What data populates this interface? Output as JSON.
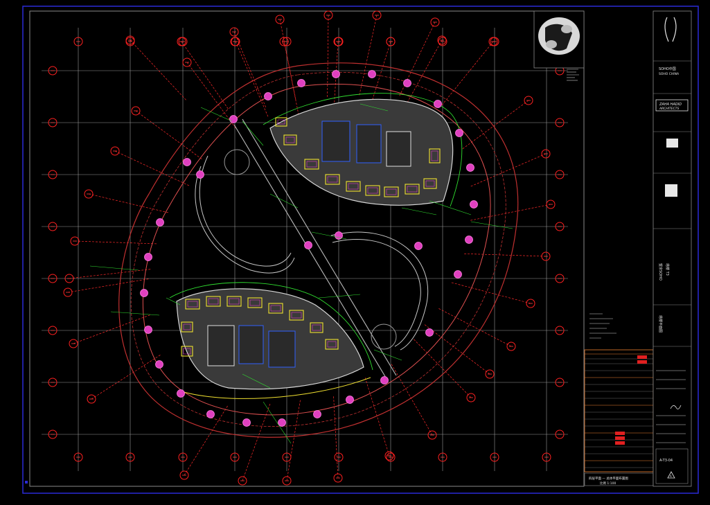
{
  "sheet": {
    "title_cn": "塔楼平面图",
    "drawing_label": "四层平面 — 总体平面布置图",
    "scale_label": "比例 1:100",
    "revision_mark": "A"
  },
  "colors": {
    "background": "#000000",
    "border": "#2a2ad8",
    "grid": "#b9b9b9",
    "axis_tag": "#ff2020",
    "wall": "#c8c8c8",
    "column": "#e040c0",
    "room": "#f0e030",
    "annotation": "#30e030",
    "stair": "#3060ff",
    "outer_ring": "#c03030"
  },
  "title_block": {
    "logo_icon": "twin-tower-logo-icon",
    "firm_lines": [
      "SOHO中国",
      "SOHO CHINA"
    ],
    "partner_lines": [
      "ZAHA HADID",
      "ARCHITECTS"
    ],
    "project_lines": [
      "望京SOHO",
      "塔楼 T3"
    ],
    "sheet_number": "A-T3-04"
  }
}
